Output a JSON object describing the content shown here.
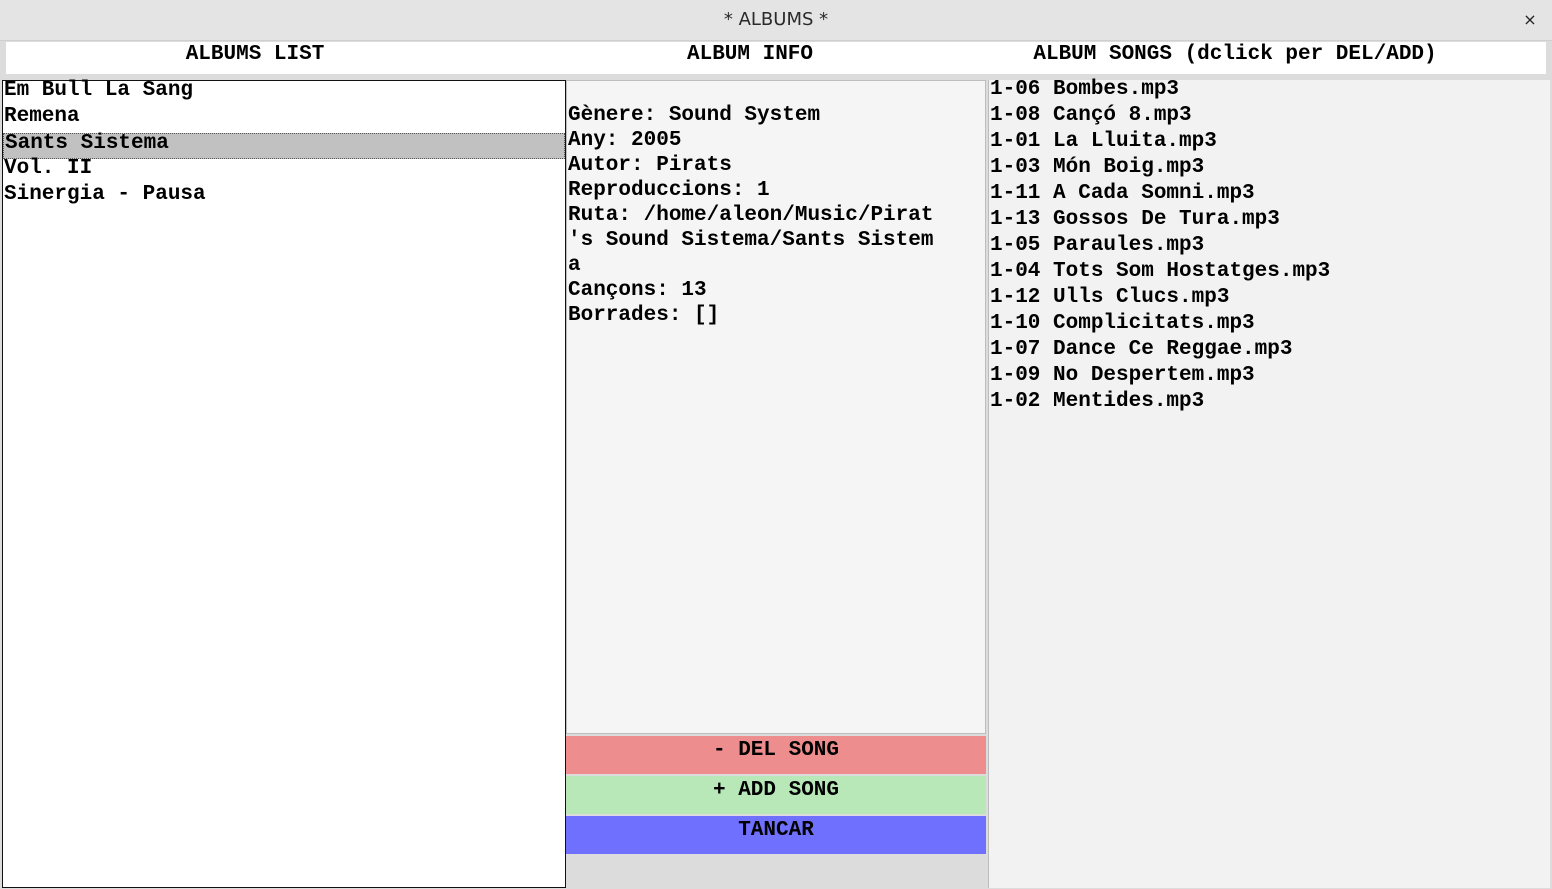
{
  "window": {
    "title": "* ALBUMS *",
    "close_glyph": "×"
  },
  "headers": {
    "albums": "ALBUMS LIST",
    "info": "ALBUM INFO",
    "songs": "ALBUM SONGS (dclick per DEL/ADD)"
  },
  "albums": {
    "items": [
      "Em Bull La Sang",
      "Remena",
      "Sants Sistema",
      "Vol. II",
      "Sinergia - Pausa"
    ],
    "selected_index": 2
  },
  "info": {
    "lines": [
      "Gènere: Sound System",
      "Any: 2005",
      "Autor: Pirats",
      "Reproduccions: 1",
      "Ruta: /home/aleon/Music/Pirat",
      "'s Sound Sistema/Sants Sistem",
      "a",
      "Cançons: 13",
      "Borrades: []"
    ]
  },
  "buttons": {
    "del": {
      "label": "- DEL SONG",
      "color": "#ed8d8d"
    },
    "add": {
      "label": "+ ADD SONG",
      "color": "#b8e8b8"
    },
    "close": {
      "label": "TANCAR",
      "color": "#7070ff"
    }
  },
  "songs": [
    "1-06 Bombes.mp3",
    "1-08 Cançó 8.mp3",
    "1-01 La Lluita.mp3",
    "1-03 Món Boig.mp3",
    "1-11 A Cada Somni.mp3",
    "1-13 Gossos De Tura.mp3",
    "1-05 Paraules.mp3",
    "1-04 Tots Som Hostatges.mp3",
    "1-12 Ulls Clucs.mp3",
    "1-10 Complicitats.mp3",
    "1-07 Dance Ce Reggae.mp3",
    "1-09 No Despertem.mp3",
    "1-02 Mentides.mp3"
  ]
}
